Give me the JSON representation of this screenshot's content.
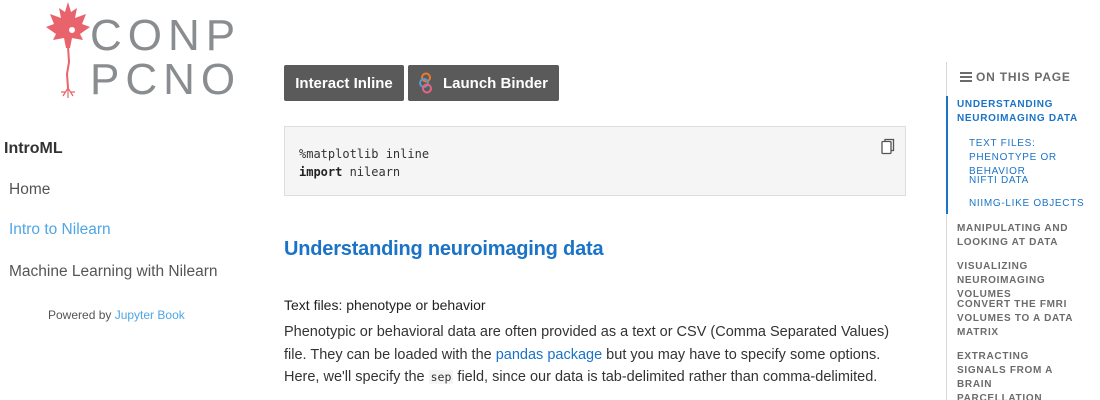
{
  "logo": {
    "line1": "CONP",
    "line2": "PCNO"
  },
  "sidebar": {
    "title": "IntroML",
    "items": [
      {
        "label": "Home"
      },
      {
        "label": "Intro to Nilearn"
      },
      {
        "label": "Machine Learning with Nilearn"
      }
    ],
    "powered_prefix": "Powered by ",
    "powered_link": "Jupyter Book"
  },
  "toolbar": {
    "interact_label": "Interact Inline",
    "binder_label": "Launch Binder"
  },
  "code": {
    "line1": "%matplotlib inline",
    "line2_kw": "import",
    "line2_rest": " nilearn"
  },
  "main": {
    "heading": "Understanding neuroimaging data",
    "subheading": "Text files: phenotype or behavior",
    "para_1": "Phenotypic or behavioral data are often provided as a text or CSV (Comma Separated Values) file. They can be loaded with the ",
    "para_link": "pandas package",
    "para_2": " but you may have to specify some options. Here, we'll specify the ",
    "para_code": "sep",
    "para_3": " field, since our data is tab-delimited rather than comma-delimited."
  },
  "toc": {
    "heading": "ON THIS PAGE",
    "items": [
      {
        "label": "UNDERSTANDING NEUROIMAGING DATA"
      },
      {
        "label": "TEXT FILES: PHENOTYPE OR BEHAVIOR"
      },
      {
        "label": "NIFTI DATA"
      },
      {
        "label": "NIIMG-LIKE OBJECTS"
      },
      {
        "label": "MANIPULATING AND LOOKING AT DATA"
      },
      {
        "label": "VISUALIZING NEUROIMAGING VOLUMES"
      },
      {
        "label": "CONVERT THE FMRI VOLUMES TO A DATA MATRIX"
      },
      {
        "label": "EXTRACTING SIGNALS FROM A BRAIN PARCELLATION"
      }
    ]
  },
  "colors": {
    "accent": "#1a73c7",
    "sidebar_active": "#4ea6e6",
    "button_bg": "#5a5a5a",
    "logo_leaf": "#e8636b"
  },
  "icons": {
    "logo": "maple-leaf-brain-icon",
    "binder": "binder-logo-icon",
    "copy": "copy-icon",
    "toc": "list-icon"
  }
}
